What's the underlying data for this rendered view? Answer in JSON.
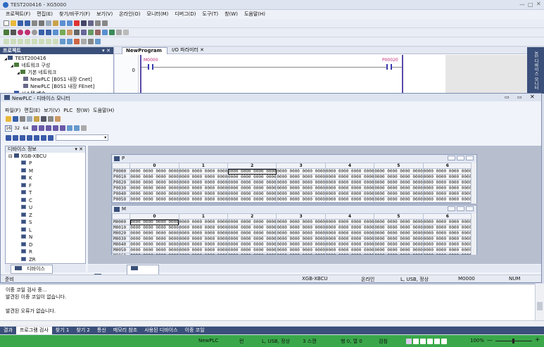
{
  "app": {
    "title": "TEST200416 - XG5000",
    "menu": [
      "프로젝트(F)",
      "편집(E)",
      "찾기/바꾸기(F)",
      "보기(V)",
      "온라인(O)",
      "모니터(M)",
      "디버그(D)",
      "도구(T)",
      "창(W)",
      "도움말(H)"
    ]
  },
  "project_panel": {
    "title": "프로젝트",
    "tree": [
      {
        "label": "TEST200416",
        "indent": 0,
        "icon": "project-icon"
      },
      {
        "label": "네트워크 구성",
        "indent": 1,
        "icon": "network-icon"
      },
      {
        "label": "기본 네트워크",
        "indent": 2,
        "icon": "network-icon"
      },
      {
        "label": "NewPLC [B0S1 내장 Cnet]",
        "indent": 3,
        "icon": "plc-icon"
      },
      {
        "label": "NewPLC [B0S1 내장 FEnet]",
        "indent": 3,
        "icon": "plc-icon"
      },
      {
        "label": "시스템 변수",
        "indent": 1,
        "icon": "folder-icon"
      }
    ]
  },
  "editor": {
    "tabs": [
      {
        "label": "NewProgram",
        "active": true
      },
      {
        "label": "I/O 파라미터",
        "active": false
      }
    ],
    "row_number": "0",
    "contact1": "M0000",
    "contact2": "P00020"
  },
  "side_tab": "XG 디바이스 모니터",
  "device_monitor": {
    "title": "NewPLC - 디바이스 모니터",
    "menu": [
      "파일(F)",
      "편집(E)",
      "보기(V)",
      "PLC",
      "창(W)",
      "도움말(H)"
    ],
    "toolbar_nums": [
      "16",
      "32",
      "64"
    ],
    "device_info_title": "디바이스 정보",
    "device_root": "XGB-XBCU",
    "devices": [
      "P",
      "M",
      "K",
      "F",
      "T",
      "C",
      "U",
      "Z",
      "S",
      "L",
      "N",
      "D",
      "R",
      "ZR"
    ],
    "bottom_tab": "디바이스",
    "window_tabs": [
      "P",
      "M"
    ],
    "p_window": {
      "title": "P",
      "columns": [
        "0",
        "1",
        "2",
        "3",
        "4",
        "5",
        "6"
      ],
      "rows": [
        "P0000",
        "P0010",
        "P0020",
        "P0030",
        "P0040",
        "P0050"
      ],
      "cell_value": "0000 0000 0000 0000"
    },
    "m_window": {
      "title": "M",
      "columns": [
        "0",
        "1",
        "2",
        "3",
        "4",
        "5",
        "6"
      ],
      "rows": [
        "M0000",
        "M0010",
        "M0020",
        "M0030",
        "M0040",
        "M0050",
        "M0060"
      ],
      "cell_value": "0000 0000 0000 0000"
    },
    "statusbar": {
      "ready": "준비",
      "cpu": "XGB-XBCU",
      "mode": "온라인",
      "conn": "L, USB, 정상",
      "addr": "M0000",
      "num": "NUM"
    }
  },
  "output": {
    "lines": [
      "이중 코일 검사 중...",
      "발견된 이중 코일이 없습니다.",
      "",
      "발견된 오류가 없습니다."
    ],
    "tabs": [
      "결과",
      "프로그램 검사",
      "찾기 1",
      "찾기 2",
      "통신",
      "메모리 참조",
      "사용된 디바이스",
      "이중 코일"
    ],
    "active_tab": "프로그램 검사"
  },
  "statusbar": {
    "plc": "NewPLC",
    "run": "런",
    "conn": "L, USB, 정상",
    "scan": "3 스캔",
    "pos": "행 0, 열 0",
    "check": "검침",
    "zoom": "100%"
  },
  "colors": {
    "accent": "#3a4f79",
    "green_status": "#3aa84a",
    "contact_pink": "#c02a7a"
  }
}
